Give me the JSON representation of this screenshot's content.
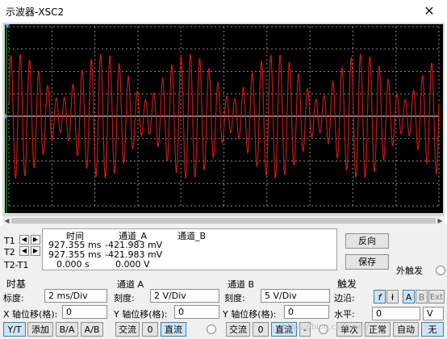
{
  "window": {
    "title": "示波器-XSC2",
    "close_glyph": "✕"
  },
  "cursors": {
    "t1_label": "T1",
    "t2_label": "T2",
    "t2t1_label": "T2-T1",
    "col_time": "时间",
    "col_a": "通道_A",
    "col_b": "通道_B",
    "rows": [
      {
        "time": "927.355 ms",
        "a": "-421.983 mV",
        "b": ""
      },
      {
        "time": "927.355 ms",
        "a": "-421.983 mV",
        "b": ""
      },
      {
        "time": "0.000 s",
        "a": "0.000 V",
        "b": ""
      }
    ]
  },
  "buttons": {
    "reverse": "反向",
    "save": "保存",
    "external_trigger": "外触发"
  },
  "timebase": {
    "title": "时基",
    "scale_label": "标度:",
    "scale_value": "2 ms/Div",
    "xpos_label": "X 轴位移(格):",
    "xpos_value": "0",
    "modes": [
      "Y/T",
      "添加",
      "B/A",
      "A/B"
    ]
  },
  "channel_a": {
    "title": "通道 A",
    "scale_label": "刻度:",
    "scale_value": "2  V/Div",
    "ypos_label": "Y 轴位移(格):",
    "ypos_value": "0",
    "coupling": [
      "交流",
      "0",
      "直流"
    ]
  },
  "channel_b": {
    "title": "通道 B",
    "scale_label": "刻度:",
    "scale_value": "5  V/Div",
    "ypos_label": "Y 轴位移(格):",
    "ypos_value": "0",
    "coupling": [
      "交流",
      "0",
      "直流",
      "-"
    ]
  },
  "trigger": {
    "title": "触发",
    "edge_label": "边沿:",
    "edge_rise": "f",
    "edge_fall": "ł",
    "source_a": "A",
    "source_b": "B",
    "source_ext": "Ext",
    "level_label": "水平:",
    "level_value": "0",
    "level_unit": "V",
    "modes": [
      "单次",
      "正常",
      "自动",
      "无"
    ]
  },
  "watermark": "https://blog.csdn.net/...",
  "colors": {
    "trace": "#c81818",
    "grid": "#8a8a8a",
    "screen": "#000000",
    "marker": "#2fc02f"
  }
}
